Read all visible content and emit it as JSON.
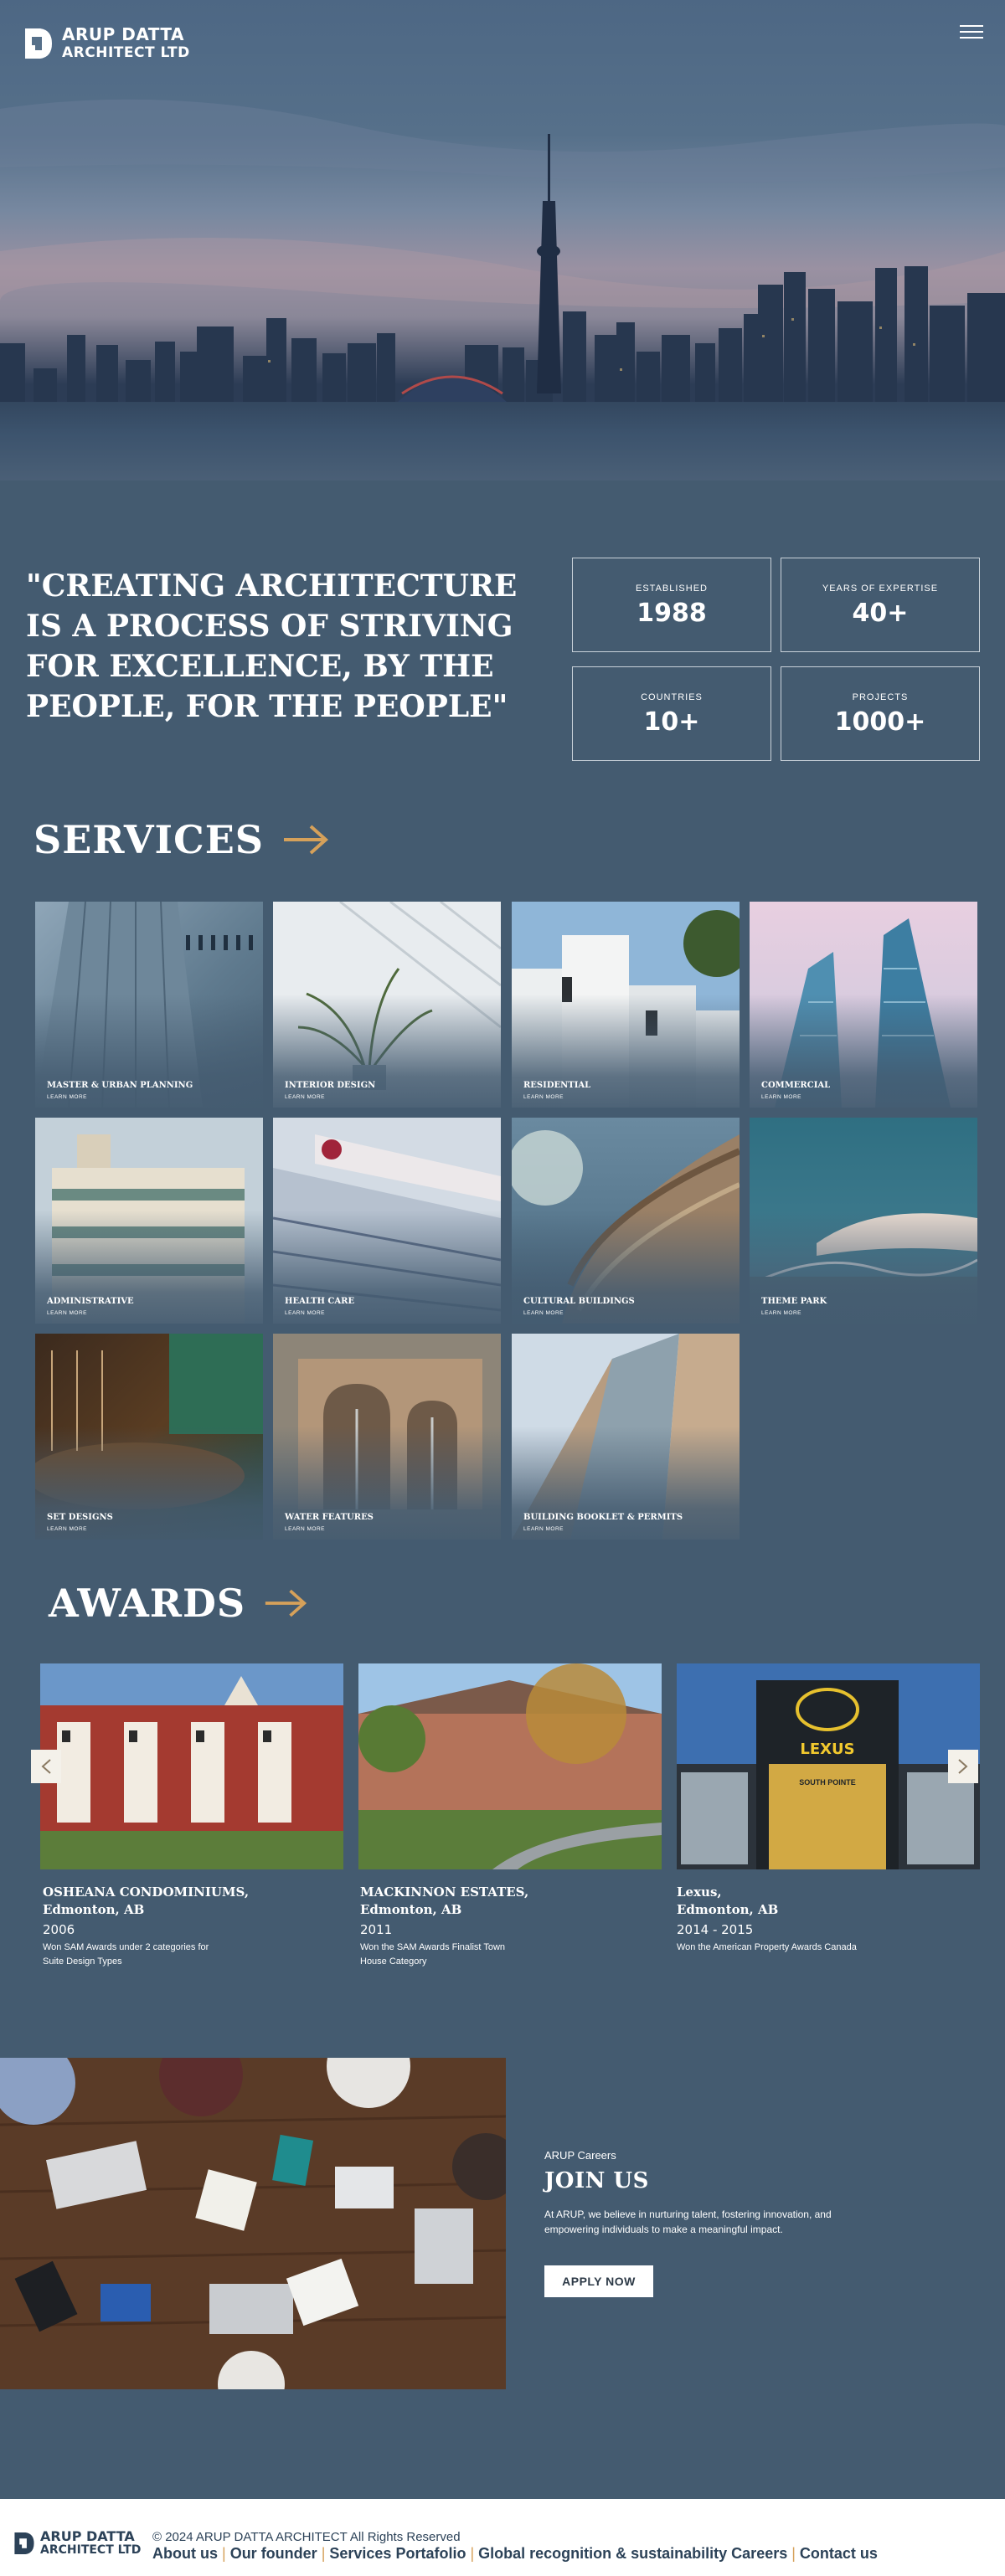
{
  "brand": {
    "line1": "ARUP DATTA",
    "line2": "ARCHITECT LTD"
  },
  "hero": {
    "menu_icon": "hamburger-menu-icon"
  },
  "quote": "\"CREATING ARCHITECTURE IS A PROCESS OF STRIVING FOR EXCELLENCE, BY THE PEOPLE, FOR THE PEOPLE\"",
  "stats": [
    {
      "label": "ESTABLISHED",
      "value": "1988"
    },
    {
      "label": "YEARS OF EXPERTISE",
      "value": "40+"
    },
    {
      "label": "COUNTRIES",
      "value": "10+"
    },
    {
      "label": "PROJECTS",
      "value": "1000+"
    }
  ],
  "services": {
    "heading": "SERVICES",
    "learn_more": "LEARN MORE",
    "items": [
      {
        "name": "MASTER & URBAN PLANNING"
      },
      {
        "name": "INTERIOR DESIGN"
      },
      {
        "name": "RESIDENTIAL"
      },
      {
        "name": "COMMERCIAL"
      },
      {
        "name": "ADMINISTRATIVE"
      },
      {
        "name": "HEALTH CARE"
      },
      {
        "name": "CULTURAL BUILDINGS"
      },
      {
        "name": "THEME PARK"
      },
      {
        "name": "SET DESIGNS"
      },
      {
        "name": "WATER FEATURES"
      },
      {
        "name": "BUILDING BOOKLET & PERMITS"
      }
    ]
  },
  "awards": {
    "heading": "AWARDS",
    "items": [
      {
        "title1": "OSHEANA CONDOMINIUMS,",
        "title2": "Edmonton, AB",
        "year": "2006",
        "desc1": "Won SAM Awards under 2 categories for",
        "desc2": "Suite Design Types"
      },
      {
        "title1": "MACKINNON ESTATES,",
        "title2": "Edmonton, AB",
        "year": "2011",
        "desc1": "Won the SAM Awards Finalist Town",
        "desc2": "House Category"
      },
      {
        "title1": "Lexus,",
        "title2": "Edmonton, AB",
        "year": "2014 - 2015",
        "desc1": "Won the American Property Awards Canada",
        "desc2": ""
      }
    ],
    "sign_text": "LEXUS",
    "sign_sub": "SOUTH POINTE"
  },
  "careers": {
    "kicker": "ARUP Careers",
    "title": "JOIN US",
    "body1": "At ARUP, we believe in nurturing talent, fostering innovation, and",
    "body2": "empowering individuals to make a meaningful impact.",
    "button": "APPLY NOW"
  },
  "footer": {
    "copyright": "© 2024 ARUP DATTA ARCHITECT All Rights Reserved",
    "links": [
      "About us",
      "Our founder",
      "Services Portafolio",
      "Global recognition & sustainability Careers",
      "Contact us"
    ]
  },
  "colors": {
    "background": "#445b70",
    "accent": "#d6a15a",
    "footer_text": "#2c4258"
  }
}
